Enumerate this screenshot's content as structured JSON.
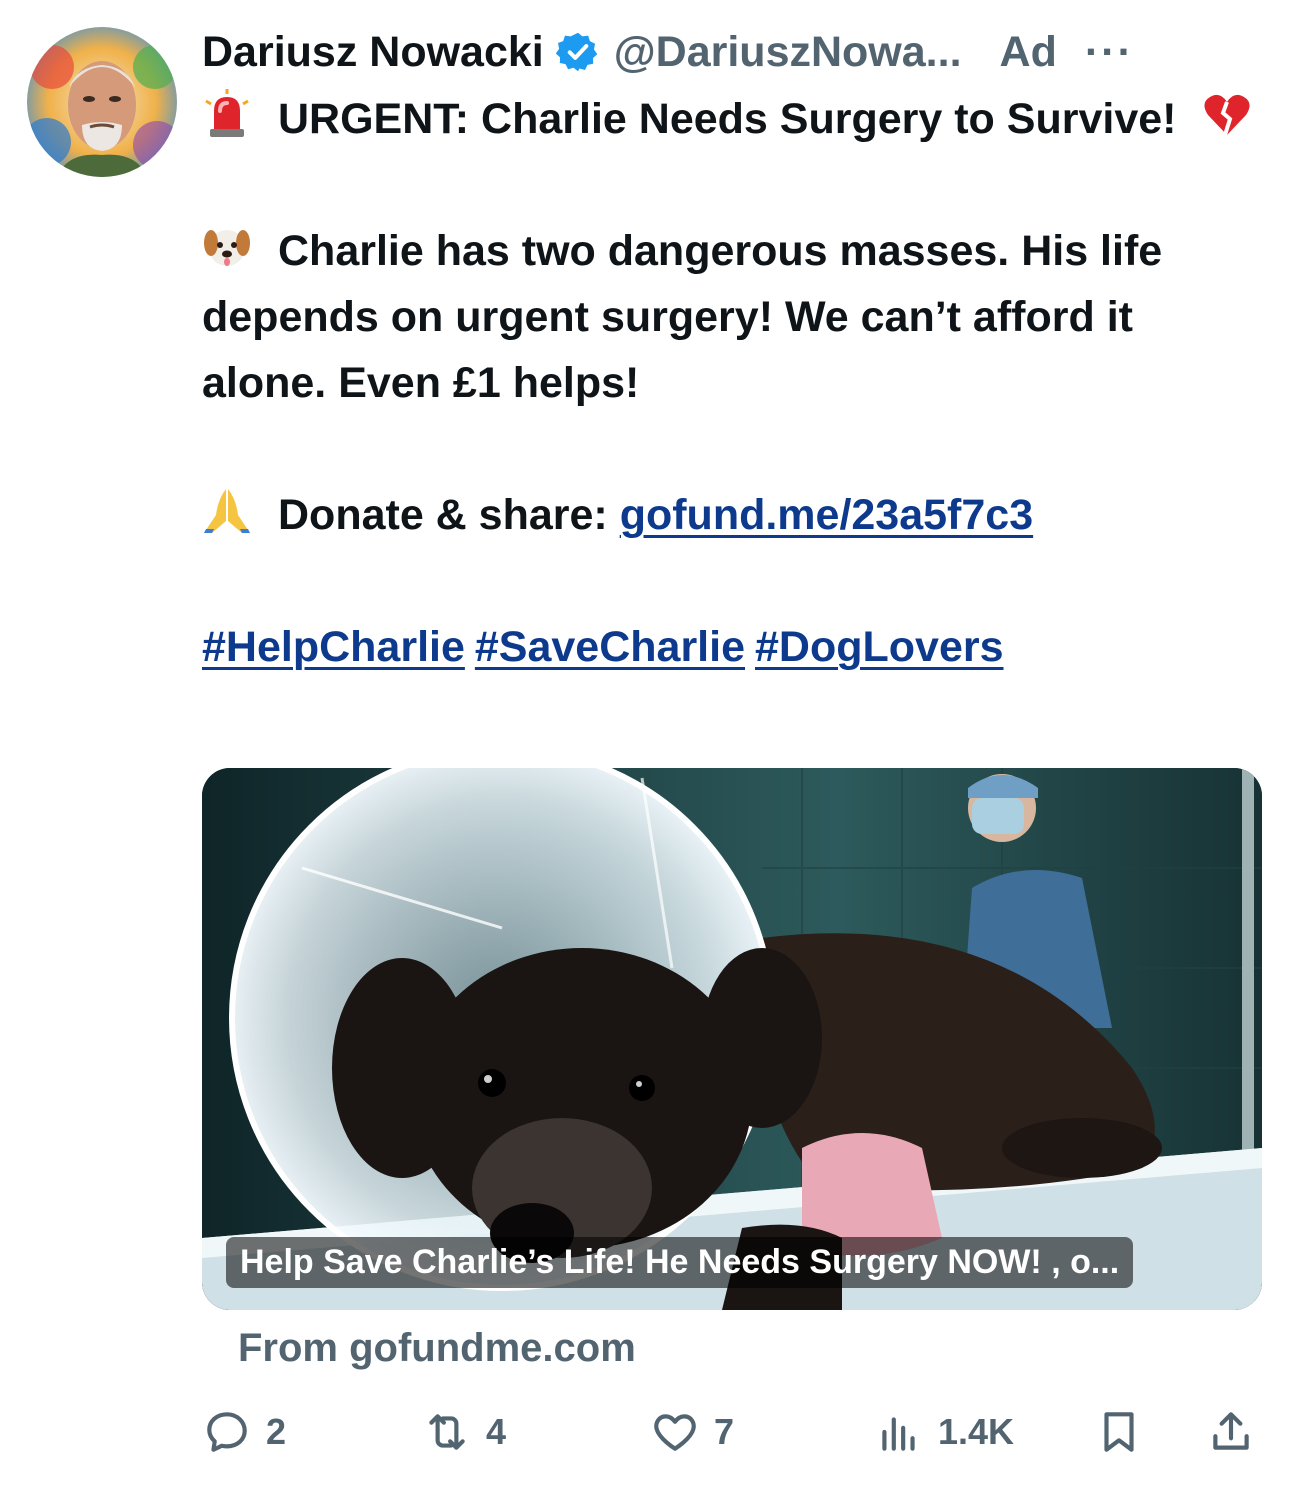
{
  "author": {
    "name": "Dariusz Nowacki",
    "handle": "@DariuszNowa...",
    "ad_label": "Ad",
    "more_label": "···"
  },
  "post": {
    "line1": "URGENT: Charlie Needs Surgery to Survive!",
    "line2": "Charlie has two dangerous masses. His life depends on urgent surgery! We can’t afford it alone. Even £1 helps!",
    "donate_prefix": "Donate & share: ",
    "donate_link": "gofund.me/23a5f7c3",
    "hashtags": [
      "#HelpCharlie",
      "#SaveCharlie",
      "#DogLovers"
    ]
  },
  "card": {
    "caption": "Help Save Charlie’s Life! He Needs Surgery NOW! , o...",
    "source": "From gofundme.com"
  },
  "actions": {
    "replies": "2",
    "reposts": "4",
    "likes": "7",
    "views": "1.4K"
  },
  "icons": [
    "verified-badge-icon",
    "siren-emoji-icon",
    "broken-heart-emoji-icon",
    "dog-face-emoji-icon",
    "praying-hands-emoji-icon",
    "reply-icon",
    "repost-icon",
    "like-icon",
    "views-icon",
    "bookmark-icon",
    "share-icon"
  ],
  "colors": {
    "link": "#0d3a8c",
    "muted": "#536471",
    "verified": "#1d9bf0"
  }
}
